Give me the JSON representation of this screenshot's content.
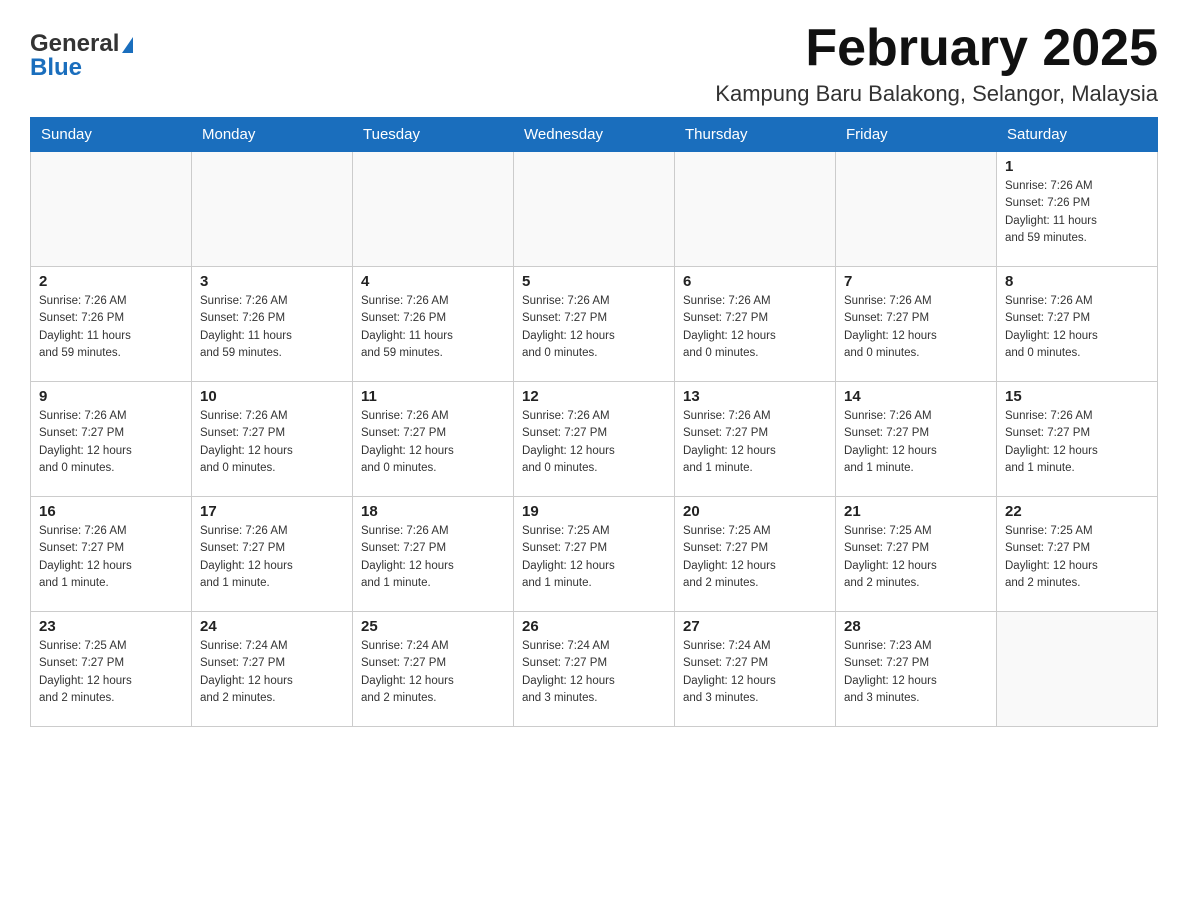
{
  "header": {
    "logo_general": "General",
    "logo_blue": "Blue",
    "month_title": "February 2025",
    "subtitle": "Kampung Baru Balakong, Selangor, Malaysia"
  },
  "weekdays": [
    "Sunday",
    "Monday",
    "Tuesday",
    "Wednesday",
    "Thursday",
    "Friday",
    "Saturday"
  ],
  "weeks": [
    [
      {
        "day": "",
        "info": ""
      },
      {
        "day": "",
        "info": ""
      },
      {
        "day": "",
        "info": ""
      },
      {
        "day": "",
        "info": ""
      },
      {
        "day": "",
        "info": ""
      },
      {
        "day": "",
        "info": ""
      },
      {
        "day": "1",
        "info": "Sunrise: 7:26 AM\nSunset: 7:26 PM\nDaylight: 11 hours\nand 59 minutes."
      }
    ],
    [
      {
        "day": "2",
        "info": "Sunrise: 7:26 AM\nSunset: 7:26 PM\nDaylight: 11 hours\nand 59 minutes."
      },
      {
        "day": "3",
        "info": "Sunrise: 7:26 AM\nSunset: 7:26 PM\nDaylight: 11 hours\nand 59 minutes."
      },
      {
        "day": "4",
        "info": "Sunrise: 7:26 AM\nSunset: 7:26 PM\nDaylight: 11 hours\nand 59 minutes."
      },
      {
        "day": "5",
        "info": "Sunrise: 7:26 AM\nSunset: 7:27 PM\nDaylight: 12 hours\nand 0 minutes."
      },
      {
        "day": "6",
        "info": "Sunrise: 7:26 AM\nSunset: 7:27 PM\nDaylight: 12 hours\nand 0 minutes."
      },
      {
        "day": "7",
        "info": "Sunrise: 7:26 AM\nSunset: 7:27 PM\nDaylight: 12 hours\nand 0 minutes."
      },
      {
        "day": "8",
        "info": "Sunrise: 7:26 AM\nSunset: 7:27 PM\nDaylight: 12 hours\nand 0 minutes."
      }
    ],
    [
      {
        "day": "9",
        "info": "Sunrise: 7:26 AM\nSunset: 7:27 PM\nDaylight: 12 hours\nand 0 minutes."
      },
      {
        "day": "10",
        "info": "Sunrise: 7:26 AM\nSunset: 7:27 PM\nDaylight: 12 hours\nand 0 minutes."
      },
      {
        "day": "11",
        "info": "Sunrise: 7:26 AM\nSunset: 7:27 PM\nDaylight: 12 hours\nand 0 minutes."
      },
      {
        "day": "12",
        "info": "Sunrise: 7:26 AM\nSunset: 7:27 PM\nDaylight: 12 hours\nand 0 minutes."
      },
      {
        "day": "13",
        "info": "Sunrise: 7:26 AM\nSunset: 7:27 PM\nDaylight: 12 hours\nand 1 minute."
      },
      {
        "day": "14",
        "info": "Sunrise: 7:26 AM\nSunset: 7:27 PM\nDaylight: 12 hours\nand 1 minute."
      },
      {
        "day": "15",
        "info": "Sunrise: 7:26 AM\nSunset: 7:27 PM\nDaylight: 12 hours\nand 1 minute."
      }
    ],
    [
      {
        "day": "16",
        "info": "Sunrise: 7:26 AM\nSunset: 7:27 PM\nDaylight: 12 hours\nand 1 minute."
      },
      {
        "day": "17",
        "info": "Sunrise: 7:26 AM\nSunset: 7:27 PM\nDaylight: 12 hours\nand 1 minute."
      },
      {
        "day": "18",
        "info": "Sunrise: 7:26 AM\nSunset: 7:27 PM\nDaylight: 12 hours\nand 1 minute."
      },
      {
        "day": "19",
        "info": "Sunrise: 7:25 AM\nSunset: 7:27 PM\nDaylight: 12 hours\nand 1 minute."
      },
      {
        "day": "20",
        "info": "Sunrise: 7:25 AM\nSunset: 7:27 PM\nDaylight: 12 hours\nand 2 minutes."
      },
      {
        "day": "21",
        "info": "Sunrise: 7:25 AM\nSunset: 7:27 PM\nDaylight: 12 hours\nand 2 minutes."
      },
      {
        "day": "22",
        "info": "Sunrise: 7:25 AM\nSunset: 7:27 PM\nDaylight: 12 hours\nand 2 minutes."
      }
    ],
    [
      {
        "day": "23",
        "info": "Sunrise: 7:25 AM\nSunset: 7:27 PM\nDaylight: 12 hours\nand 2 minutes."
      },
      {
        "day": "24",
        "info": "Sunrise: 7:24 AM\nSunset: 7:27 PM\nDaylight: 12 hours\nand 2 minutes."
      },
      {
        "day": "25",
        "info": "Sunrise: 7:24 AM\nSunset: 7:27 PM\nDaylight: 12 hours\nand 2 minutes."
      },
      {
        "day": "26",
        "info": "Sunrise: 7:24 AM\nSunset: 7:27 PM\nDaylight: 12 hours\nand 3 minutes."
      },
      {
        "day": "27",
        "info": "Sunrise: 7:24 AM\nSunset: 7:27 PM\nDaylight: 12 hours\nand 3 minutes."
      },
      {
        "day": "28",
        "info": "Sunrise: 7:23 AM\nSunset: 7:27 PM\nDaylight: 12 hours\nand 3 minutes."
      },
      {
        "day": "",
        "info": ""
      }
    ]
  ]
}
